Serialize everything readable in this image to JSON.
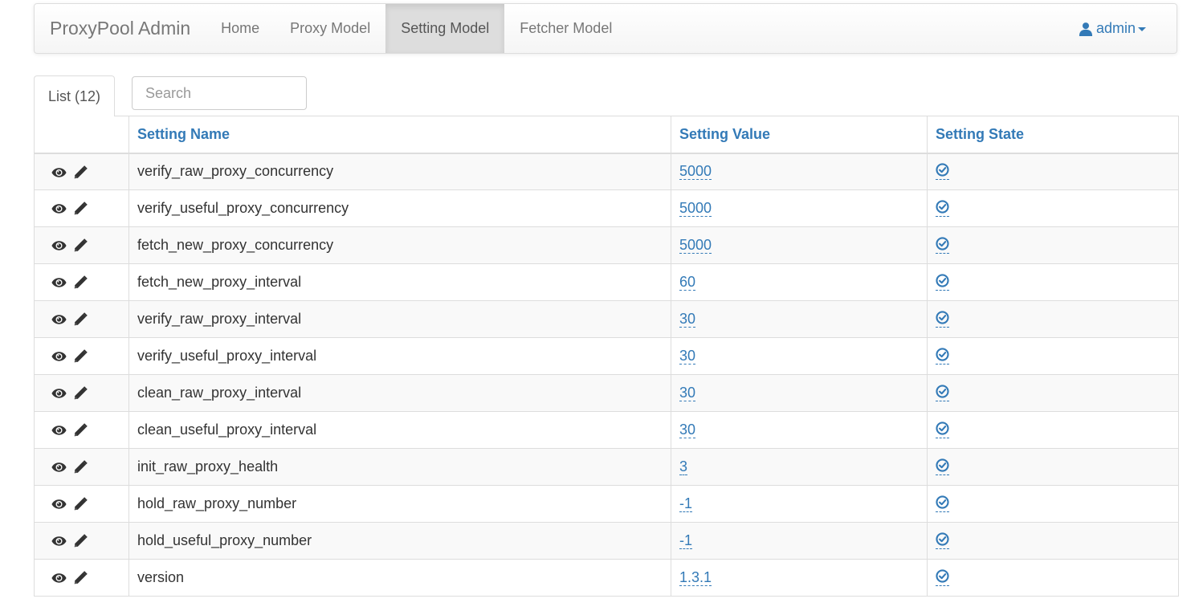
{
  "nav": {
    "brand": "ProxyPool Admin",
    "items": [
      {
        "label": "Home",
        "active": false
      },
      {
        "label": "Proxy Model",
        "active": false
      },
      {
        "label": "Setting Model",
        "active": true
      },
      {
        "label": "Fetcher Model",
        "active": false
      }
    ],
    "user": "admin"
  },
  "list": {
    "tab_label": "List (12)",
    "search_placeholder": "Search"
  },
  "table": {
    "columns": [
      "Setting Name",
      "Setting Value",
      "Setting State"
    ],
    "rows": [
      {
        "name": "verify_raw_proxy_concurrency",
        "value": "5000",
        "state_icon": "check-circle-icon"
      },
      {
        "name": "verify_useful_proxy_concurrency",
        "value": "5000",
        "state_icon": "check-circle-icon"
      },
      {
        "name": "fetch_new_proxy_concurrency",
        "value": "5000",
        "state_icon": "check-circle-icon"
      },
      {
        "name": "fetch_new_proxy_interval",
        "value": "60",
        "state_icon": "check-circle-icon"
      },
      {
        "name": "verify_raw_proxy_interval",
        "value": "30",
        "state_icon": "check-circle-icon"
      },
      {
        "name": "verify_useful_proxy_interval",
        "value": "30",
        "state_icon": "check-circle-icon"
      },
      {
        "name": "clean_raw_proxy_interval",
        "value": "30",
        "state_icon": "check-circle-icon"
      },
      {
        "name": "clean_useful_proxy_interval",
        "value": "30",
        "state_icon": "check-circle-icon"
      },
      {
        "name": "init_raw_proxy_health",
        "value": "3",
        "state_icon": "check-circle-icon"
      },
      {
        "name": "hold_raw_proxy_number",
        "value": "-1",
        "state_icon": "check-circle-icon"
      },
      {
        "name": "hold_useful_proxy_number",
        "value": "-1",
        "state_icon": "check-circle-icon"
      },
      {
        "name": "version",
        "value": "1.3.1",
        "state_icon": "check-circle-icon"
      }
    ]
  },
  "colors": {
    "link": "#337ab7",
    "nav_text": "#777777",
    "active_nav_bg": "#dddddd",
    "border": "#dddddd",
    "stripe": "#f9f9f9"
  }
}
